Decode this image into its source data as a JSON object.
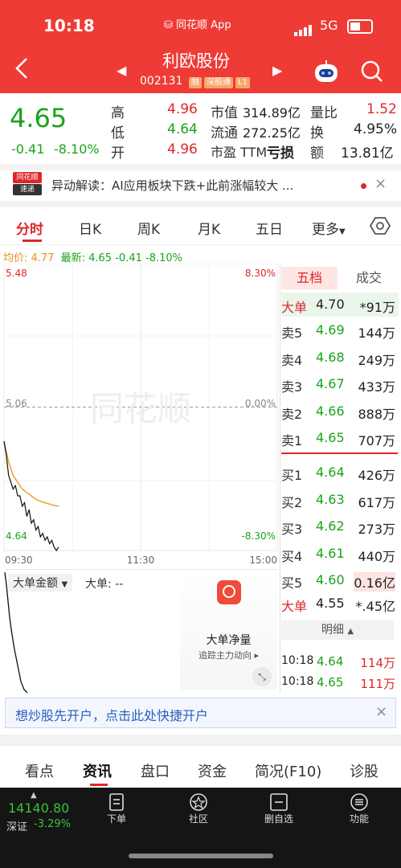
{
  "status_bar": {
    "time": "10:18",
    "notification": "同花顺 App",
    "network": "5G"
  },
  "header": {
    "stock_name": "利欧股份",
    "stock_code": "002131",
    "badges": [
      "融",
      "深股通",
      "L1"
    ]
  },
  "quote": {
    "price": "4.65",
    "change": "-0.41",
    "change_pct": "-8.10%",
    "stats": [
      {
        "label": "高",
        "value": "4.96",
        "color": "red"
      },
      {
        "label": "低",
        "value": "4.64",
        "color": "green"
      },
      {
        "label": "开",
        "value": "4.96",
        "color": "red"
      },
      {
        "label": "市值",
        "value": "314.89亿"
      },
      {
        "label": "流通",
        "value": "272.25亿"
      },
      {
        "label": "市盈 TTM",
        "value": "亏损"
      },
      {
        "label": "量比",
        "value": "1.52",
        "color": "red"
      },
      {
        "label": "换",
        "value": "4.95%"
      },
      {
        "label": "额",
        "value": "13.81亿"
      }
    ]
  },
  "news": {
    "logo_top": "同花顺",
    "logo_bottom": "速递",
    "text": "异动解读：AI应用板块下跌+此前涨幅较大 ..."
  },
  "tabs": [
    "分时",
    "日K",
    "周K",
    "月K",
    "五日",
    "更多"
  ],
  "active_tab": "分时",
  "chart_info": {
    "avg_label": "均价: 4.77",
    "last_label": "最新: 4.65",
    "change": "-0.41",
    "change_pct": "-8.10%"
  },
  "chart_data": {
    "type": "line",
    "y_ticks_left": [
      "5.48",
      "5.06",
      "4.64"
    ],
    "y_ticks_right": [
      "8.30%",
      "0.00%",
      "-8.30%"
    ],
    "x_ticks": [
      "09:30",
      "11:30",
      "15:00"
    ],
    "ylim": [
      4.64,
      5.48
    ],
    "prev_close": 5.06,
    "series": [
      {
        "values": [
          4.96,
          4.92,
          4.86,
          4.84,
          4.82,
          4.83,
          4.8,
          4.8,
          4.77,
          4.78,
          4.74,
          4.76,
          4.72,
          4.73,
          4.7,
          4.71,
          4.68,
          4.69,
          4.67,
          4.68,
          4.66,
          4.67,
          4.65,
          4.64,
          4.65
        ]
      },
      {
        "values": [
          4.96,
          4.93,
          4.9,
          4.88,
          4.86,
          4.85,
          4.84,
          4.83,
          4.82,
          4.815,
          4.81,
          4.805,
          4.8,
          4.795,
          4.79,
          4.787,
          4.785,
          4.782,
          4.78,
          4.778,
          4.776,
          4.774,
          4.772,
          4.771,
          4.77
        ]
      }
    ],
    "watermark": "同花顺"
  },
  "sub_chart": {
    "dropdown": "大单金额",
    "label": "大单: --",
    "promo_title": "大单净量",
    "promo_sub": "追踪主力动向"
  },
  "depth": {
    "tab_five": "五档",
    "tab_trades": "成交",
    "big_sell": {
      "label": "大单",
      "price": "4.70",
      "vol": "*91万"
    },
    "sells": [
      {
        "label": "卖5",
        "price": "4.69",
        "vol": "144万"
      },
      {
        "label": "卖4",
        "price": "4.68",
        "vol": "249万"
      },
      {
        "label": "卖3",
        "price": "4.67",
        "vol": "433万"
      },
      {
        "label": "卖2",
        "price": "4.66",
        "vol": "888万"
      },
      {
        "label": "卖1",
        "price": "4.65",
        "vol": "707万"
      }
    ],
    "buys": [
      {
        "label": "买1",
        "price": "4.64",
        "vol": "426万"
      },
      {
        "label": "买2",
        "price": "4.63",
        "vol": "617万"
      },
      {
        "label": "买3",
        "price": "4.62",
        "vol": "273万"
      },
      {
        "label": "买4",
        "price": "4.61",
        "vol": "440万"
      },
      {
        "label": "买5",
        "price": "4.60",
        "vol": "0.16亿"
      }
    ],
    "big_buy": {
      "label": "大单",
      "price": "4.55",
      "vol": "*.45亿"
    },
    "detail_label": "明细",
    "trades": [
      {
        "time": "10:18",
        "price": "4.64",
        "vol": "114万"
      },
      {
        "time": "10:18",
        "price": "4.65",
        "vol": "111万"
      }
    ]
  },
  "banner": {
    "text": "想炒股先开户，点击此处快捷开户"
  },
  "bottom_tabs": [
    "看点",
    "资讯",
    "盘口",
    "资金",
    "简况(F10)",
    "诊股"
  ],
  "active_bottom_tab": "资讯",
  "index": {
    "value": "14140.80",
    "name": "深证",
    "change_pct": "-3.29%"
  },
  "bottom_nav": [
    "下单",
    "社区",
    "删自选",
    "功能"
  ]
}
